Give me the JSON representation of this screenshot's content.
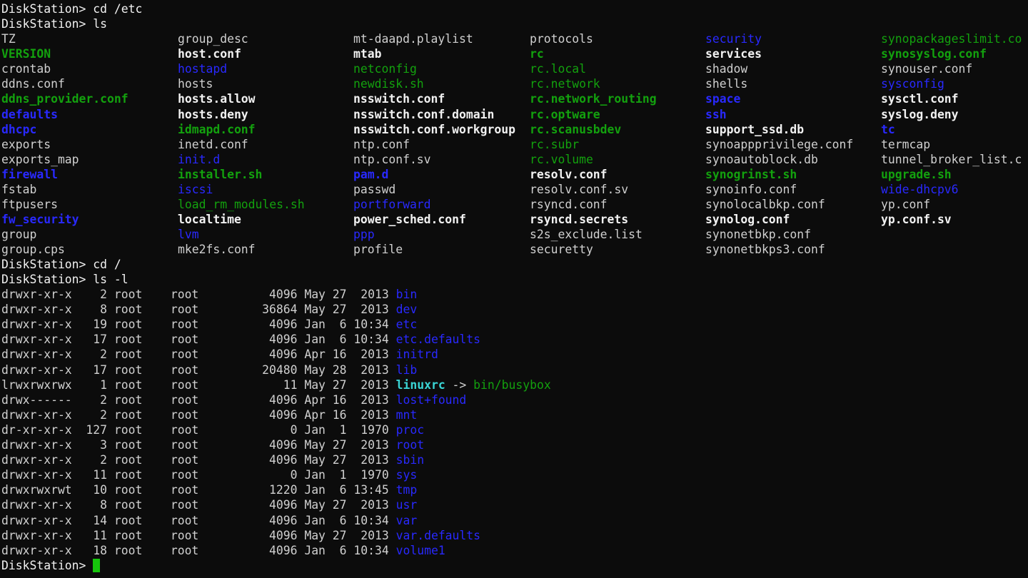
{
  "terminal": {
    "prompt": "DiskStation>",
    "commands": {
      "cd_etc": "DiskStation> cd /etc",
      "ls": "DiskStation> ls",
      "cd_root": "DiskStation> cd /",
      "ls_l": "DiskStation> ls -l",
      "final_prompt": "DiskStation> "
    },
    "colors": {
      "bg": "#0c0c0c",
      "fg": "#cccccc",
      "blue": "#2929ff",
      "green": "#13a10e",
      "cyan": "#3ad5d5",
      "cursor": "#16c60c"
    },
    "etc_listing": [
      [
        {
          "t": "TZ",
          "s": "plain"
        },
        {
          "t": "VERSION",
          "s": "green-bold"
        },
        {
          "t": "crontab",
          "s": "plain"
        },
        {
          "t": "ddns.conf",
          "s": "plain"
        },
        {
          "t": "ddns_provider.conf",
          "s": "green-bold"
        },
        {
          "t": "defaults",
          "s": "blue-bold"
        },
        {
          "t": "dhcpc",
          "s": "blue-bold"
        },
        {
          "t": "exports",
          "s": "plain"
        },
        {
          "t": "exports_map",
          "s": "plain"
        },
        {
          "t": "firewall",
          "s": "blue-bold"
        },
        {
          "t": "fstab",
          "s": "plain"
        },
        {
          "t": "ftpusers",
          "s": "plain"
        },
        {
          "t": "fw_security",
          "s": "blue-bold"
        },
        {
          "t": "group",
          "s": "plain"
        },
        {
          "t": "group.cps",
          "s": "plain"
        }
      ],
      [
        {
          "t": "group_desc",
          "s": "plain"
        },
        {
          "t": "host.conf",
          "s": "white-bold"
        },
        {
          "t": "hostapd",
          "s": "blue"
        },
        {
          "t": "hosts",
          "s": "plain"
        },
        {
          "t": "hosts.allow",
          "s": "white-bold"
        },
        {
          "t": "hosts.deny",
          "s": "white-bold"
        },
        {
          "t": "idmapd.conf",
          "s": "green-bold"
        },
        {
          "t": "inetd.conf",
          "s": "plain"
        },
        {
          "t": "init.d",
          "s": "blue"
        },
        {
          "t": "installer.sh",
          "s": "green-bold"
        },
        {
          "t": "iscsi",
          "s": "blue"
        },
        {
          "t": "load_rm_modules.sh",
          "s": "green"
        },
        {
          "t": "localtime",
          "s": "white-bold"
        },
        {
          "t": "lvm",
          "s": "blue"
        },
        {
          "t": "mke2fs.conf",
          "s": "plain"
        }
      ],
      [
        {
          "t": "mt-daapd.playlist",
          "s": "plain"
        },
        {
          "t": "mtab",
          "s": "white-bold"
        },
        {
          "t": "netconfig",
          "s": "green"
        },
        {
          "t": "newdisk.sh",
          "s": "green"
        },
        {
          "t": "nsswitch.conf",
          "s": "white-bold"
        },
        {
          "t": "nsswitch.conf.domain",
          "s": "white-bold"
        },
        {
          "t": "nsswitch.conf.workgroup",
          "s": "white-bold"
        },
        {
          "t": "ntp.conf",
          "s": "plain"
        },
        {
          "t": "ntp.conf.sv",
          "s": "plain"
        },
        {
          "t": "pam.d",
          "s": "blue-bold"
        },
        {
          "t": "passwd",
          "s": "plain"
        },
        {
          "t": "portforward",
          "s": "blue"
        },
        {
          "t": "power_sched.conf",
          "s": "white-bold"
        },
        {
          "t": "ppp",
          "s": "blue"
        },
        {
          "t": "profile",
          "s": "plain"
        }
      ],
      [
        {
          "t": "protocols",
          "s": "plain"
        },
        {
          "t": "rc",
          "s": "green-bold"
        },
        {
          "t": "rc.local",
          "s": "green"
        },
        {
          "t": "rc.network",
          "s": "green"
        },
        {
          "t": "rc.network_routing",
          "s": "green-bold"
        },
        {
          "t": "rc.optware",
          "s": "green-bold"
        },
        {
          "t": "rc.scanusbdev",
          "s": "green-bold"
        },
        {
          "t": "rc.subr",
          "s": "green"
        },
        {
          "t": "rc.volume",
          "s": "green"
        },
        {
          "t": "resolv.conf",
          "s": "white-bold"
        },
        {
          "t": "resolv.conf.sv",
          "s": "plain"
        },
        {
          "t": "rsyncd.conf",
          "s": "plain"
        },
        {
          "t": "rsyncd.secrets",
          "s": "white-bold"
        },
        {
          "t": "s2s_exclude.list",
          "s": "plain"
        },
        {
          "t": "securetty",
          "s": "plain"
        }
      ],
      [
        {
          "t": "security",
          "s": "blue"
        },
        {
          "t": "services",
          "s": "white-bold"
        },
        {
          "t": "shadow",
          "s": "plain"
        },
        {
          "t": "shells",
          "s": "plain"
        },
        {
          "t": "space",
          "s": "blue-bold"
        },
        {
          "t": "ssh",
          "s": "blue-bold"
        },
        {
          "t": "support_ssd.db",
          "s": "white-bold"
        },
        {
          "t": "synoappprivilege.conf",
          "s": "plain"
        },
        {
          "t": "synoautoblock.db",
          "s": "plain"
        },
        {
          "t": "synogrinst.sh",
          "s": "green-bold"
        },
        {
          "t": "synoinfo.conf",
          "s": "plain"
        },
        {
          "t": "synolocalbkp.conf",
          "s": "plain"
        },
        {
          "t": "synolog.conf",
          "s": "white-bold"
        },
        {
          "t": "synonetbkp.conf",
          "s": "plain"
        },
        {
          "t": "synonetbkps3.conf",
          "s": "plain"
        }
      ],
      [
        {
          "t": "synopackageslimit.co",
          "s": "green"
        },
        {
          "t": "synosyslog.conf",
          "s": "green-bold"
        },
        {
          "t": "synouser.conf",
          "s": "plain"
        },
        {
          "t": "sysconfig",
          "s": "blue"
        },
        {
          "t": "sysctl.conf",
          "s": "white-bold"
        },
        {
          "t": "syslog.deny",
          "s": "white-bold"
        },
        {
          "t": "tc",
          "s": "blue-bold"
        },
        {
          "t": "termcap",
          "s": "plain"
        },
        {
          "t": "tunnel_broker_list.c",
          "s": "plain"
        },
        {
          "t": "upgrade.sh",
          "s": "green-bold"
        },
        {
          "t": "wide-dhcpv6",
          "s": "blue"
        },
        {
          "t": "yp.conf",
          "s": "plain"
        },
        {
          "t": "yp.conf.sv",
          "s": "white-bold"
        }
      ]
    ],
    "root_listing": [
      {
        "perm": "drwxr-xr-x",
        "links": "2",
        "owner": "root",
        "group": "root",
        "size": "4096",
        "month": "May",
        "day": "27",
        "time": "2013",
        "name": "bin",
        "s": "blue"
      },
      {
        "perm": "drwxr-xr-x",
        "links": "8",
        "owner": "root",
        "group": "root",
        "size": "36864",
        "month": "May",
        "day": "27",
        "time": "2013",
        "name": "dev",
        "s": "blue"
      },
      {
        "perm": "drwxr-xr-x",
        "links": "19",
        "owner": "root",
        "group": "root",
        "size": "4096",
        "month": "Jan",
        "day": "6",
        "time": "10:34",
        "name": "etc",
        "s": "blue"
      },
      {
        "perm": "drwxr-xr-x",
        "links": "17",
        "owner": "root",
        "group": "root",
        "size": "4096",
        "month": "Jan",
        "day": "6",
        "time": "10:34",
        "name": "etc.defaults",
        "s": "blue"
      },
      {
        "perm": "drwxr-xr-x",
        "links": "2",
        "owner": "root",
        "group": "root",
        "size": "4096",
        "month": "Apr",
        "day": "16",
        "time": "2013",
        "name": "initrd",
        "s": "blue"
      },
      {
        "perm": "drwxr-xr-x",
        "links": "17",
        "owner": "root",
        "group": "root",
        "size": "20480",
        "month": "May",
        "day": "28",
        "time": "2013",
        "name": "lib",
        "s": "blue"
      },
      {
        "perm": "lrwxrwxrwx",
        "links": "1",
        "owner": "root",
        "group": "root",
        "size": "11",
        "month": "May",
        "day": "27",
        "time": "2013",
        "name": "linuxrc",
        "s": "cyan-bold",
        "arrow": " -> ",
        "target": "bin/busybox"
      },
      {
        "perm": "drwx------",
        "links": "2",
        "owner": "root",
        "group": "root",
        "size": "4096",
        "month": "Apr",
        "day": "16",
        "time": "2013",
        "name": "lost+found",
        "s": "blue"
      },
      {
        "perm": "drwxr-xr-x",
        "links": "2",
        "owner": "root",
        "group": "root",
        "size": "4096",
        "month": "Apr",
        "day": "16",
        "time": "2013",
        "name": "mnt",
        "s": "blue"
      },
      {
        "perm": "dr-xr-xr-x",
        "links": "127",
        "owner": "root",
        "group": "root",
        "size": "0",
        "month": "Jan",
        "day": "1",
        "time": "1970",
        "name": "proc",
        "s": "blue"
      },
      {
        "perm": "drwxr-xr-x",
        "links": "3",
        "owner": "root",
        "group": "root",
        "size": "4096",
        "month": "May",
        "day": "27",
        "time": "2013",
        "name": "root",
        "s": "blue"
      },
      {
        "perm": "drwxr-xr-x",
        "links": "2",
        "owner": "root",
        "group": "root",
        "size": "4096",
        "month": "May",
        "day": "27",
        "time": "2013",
        "name": "sbin",
        "s": "blue"
      },
      {
        "perm": "drwxr-xr-x",
        "links": "11",
        "owner": "root",
        "group": "root",
        "size": "0",
        "month": "Jan",
        "day": "1",
        "time": "1970",
        "name": "sys",
        "s": "blue"
      },
      {
        "perm": "drwxrwxrwt",
        "links": "10",
        "owner": "root",
        "group": "root",
        "size": "1220",
        "month": "Jan",
        "day": "6",
        "time": "13:45",
        "name": "tmp",
        "s": "blue"
      },
      {
        "perm": "drwxr-xr-x",
        "links": "8",
        "owner": "root",
        "group": "root",
        "size": "4096",
        "month": "May",
        "day": "27",
        "time": "2013",
        "name": "usr",
        "s": "blue"
      },
      {
        "perm": "drwxr-xr-x",
        "links": "14",
        "owner": "root",
        "group": "root",
        "size": "4096",
        "month": "Jan",
        "day": "6",
        "time": "10:34",
        "name": "var",
        "s": "blue"
      },
      {
        "perm": "drwxr-xr-x",
        "links": "11",
        "owner": "root",
        "group": "root",
        "size": "4096",
        "month": "May",
        "day": "27",
        "time": "2013",
        "name": "var.defaults",
        "s": "blue"
      },
      {
        "perm": "drwxr-xr-x",
        "links": "18",
        "owner": "root",
        "group": "root",
        "size": "4096",
        "month": "Jan",
        "day": "6",
        "time": "10:34",
        "name": "volume1",
        "s": "blue"
      }
    ]
  }
}
